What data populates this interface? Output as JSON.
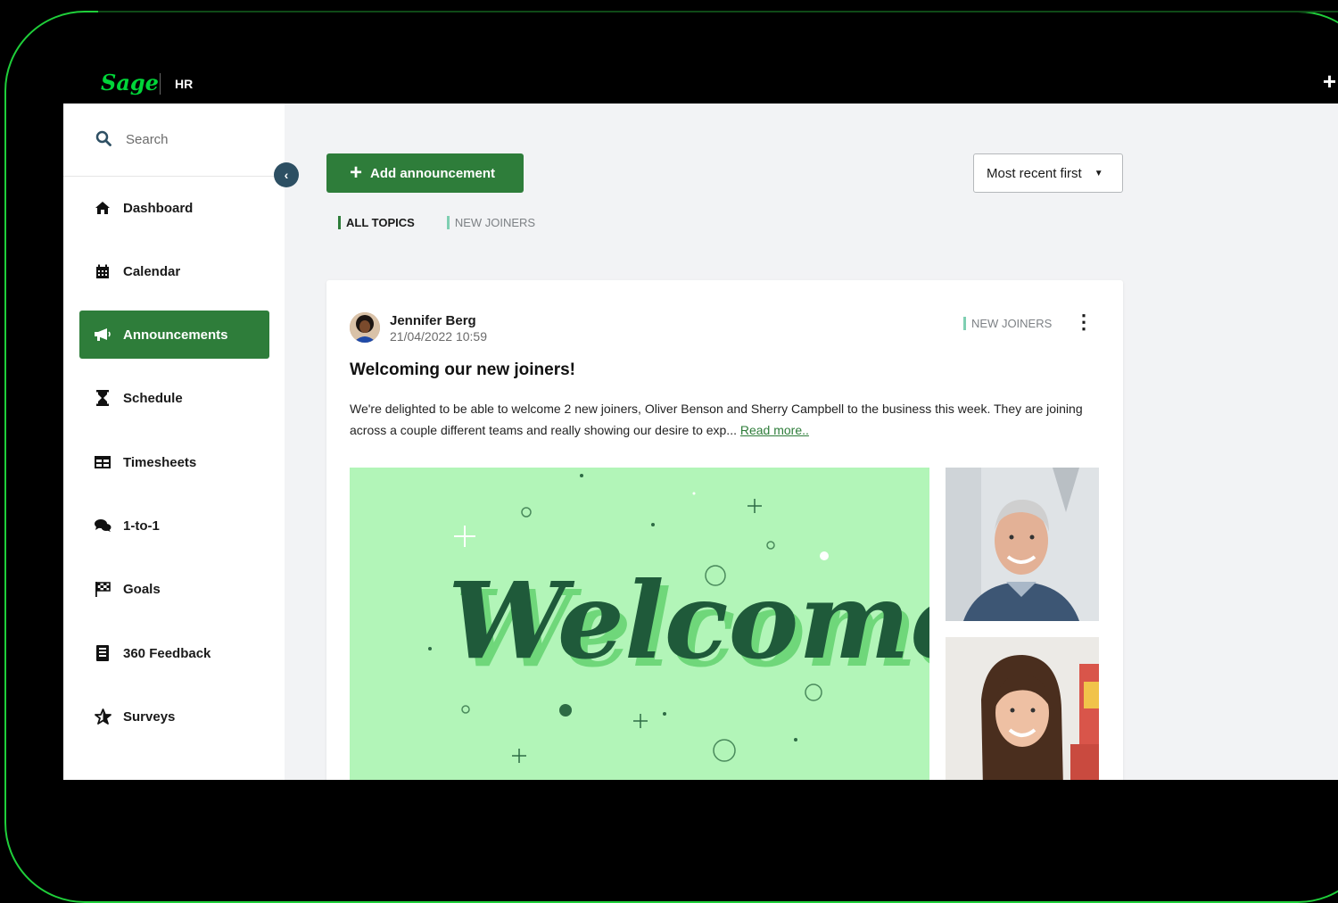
{
  "app": {
    "logo": "Sage",
    "product": "HR"
  },
  "search": {
    "placeholder": "Search"
  },
  "sidebar": {
    "items": [
      {
        "label": "Dashboard",
        "icon": "home-icon",
        "active": false
      },
      {
        "label": "Calendar",
        "icon": "calendar-icon",
        "active": false
      },
      {
        "label": "Announcements",
        "icon": "megaphone-icon",
        "active": true
      },
      {
        "label": "Schedule",
        "icon": "hourglass-icon",
        "active": false
      },
      {
        "label": "Timesheets",
        "icon": "table-icon",
        "active": false
      },
      {
        "label": "1-to-1",
        "icon": "chat-icon",
        "active": false
      },
      {
        "label": "Goals",
        "icon": "flag-icon",
        "active": false
      },
      {
        "label": "360 Feedback",
        "icon": "document-icon",
        "active": false
      },
      {
        "label": "Surveys",
        "icon": "star-icon",
        "active": false
      }
    ]
  },
  "toolbar": {
    "add_label": "Add announcement",
    "sort_label": "Most recent first"
  },
  "tabs": [
    {
      "label": "ALL TOPICS",
      "active": true
    },
    {
      "label": "NEW JOINERS",
      "active": false
    }
  ],
  "post": {
    "author": "Jennifer Berg",
    "datetime": "21/04/2022 10:59",
    "tag": "NEW JOINERS",
    "title": "Welcoming our new joiners!",
    "body": "We're delighted to be able to welcome 2 new joiners, Oliver Benson and Sherry Campbell to the business this week. They are joining across a couple different teams and really showing our desire to exp...",
    "read_more": "Read more..",
    "image_text": "Welcome"
  },
  "colors": {
    "brand_green": "#00d639",
    "primary_button": "#2e7d3a",
    "image_background": "#b2f5b8",
    "welcome_lettering": "#1f5a3a"
  }
}
